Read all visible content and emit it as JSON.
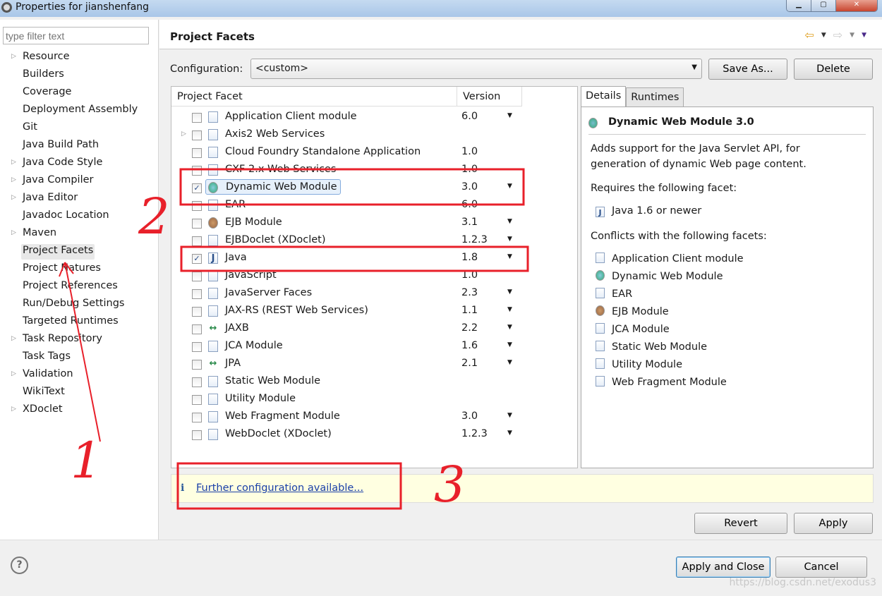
{
  "window": {
    "title": "Properties for jianshenfang",
    "controls": [
      "minimize",
      "maximize",
      "close"
    ]
  },
  "sidebar": {
    "filter_placeholder": "type filter text",
    "items": [
      {
        "label": "Resource",
        "expandable": true
      },
      {
        "label": "Builders"
      },
      {
        "label": "Coverage"
      },
      {
        "label": "Deployment Assembly"
      },
      {
        "label": "Git"
      },
      {
        "label": "Java Build Path"
      },
      {
        "label": "Java Code Style",
        "expandable": true
      },
      {
        "label": "Java Compiler",
        "expandable": true
      },
      {
        "label": "Java Editor",
        "expandable": true
      },
      {
        "label": "Javadoc Location"
      },
      {
        "label": "Maven",
        "expandable": true
      },
      {
        "label": "Project Facets",
        "selected": true
      },
      {
        "label": "Project Natures"
      },
      {
        "label": "Project References"
      },
      {
        "label": "Run/Debug Settings"
      },
      {
        "label": "Targeted Runtimes"
      },
      {
        "label": "Task Repository",
        "expandable": true
      },
      {
        "label": "Task Tags"
      },
      {
        "label": "Validation",
        "expandable": true
      },
      {
        "label": "WikiText"
      },
      {
        "label": "XDoclet",
        "expandable": true
      }
    ]
  },
  "main": {
    "title": "Project Facets",
    "configuration_label": "Configuration:",
    "configuration_value": "<custom>",
    "save_as": "Save As...",
    "delete": "Delete",
    "columns": [
      "Project Facet",
      "Version"
    ],
    "facets": [
      {
        "name": "Application Client module",
        "version": "6.0",
        "dropdown": true,
        "checked": false,
        "icon": "doc"
      },
      {
        "name": "Axis2 Web Services",
        "version": "",
        "dropdown": false,
        "checked": false,
        "icon": "doc",
        "expandable": true
      },
      {
        "name": "Cloud Foundry Standalone Application",
        "version": "1.0",
        "dropdown": false,
        "checked": false,
        "icon": "doc"
      },
      {
        "name": "CXF 2.x Web Services",
        "version": "1.0",
        "dropdown": false,
        "checked": false,
        "icon": "doc"
      },
      {
        "name": "Dynamic Web Module",
        "version": "3.0",
        "dropdown": true,
        "checked": true,
        "icon": "web",
        "selected": true
      },
      {
        "name": "EAR",
        "version": "6.0",
        "dropdown": false,
        "checked": false,
        "icon": "doc"
      },
      {
        "name": "EJB Module",
        "version": "3.1",
        "dropdown": true,
        "checked": false,
        "icon": "ejb"
      },
      {
        "name": "EJBDoclet (XDoclet)",
        "version": "1.2.3",
        "dropdown": true,
        "checked": false,
        "icon": "doc"
      },
      {
        "name": "Java",
        "version": "1.8",
        "dropdown": true,
        "checked": true,
        "icon": "java"
      },
      {
        "name": "JavaScript",
        "version": "1.0",
        "dropdown": false,
        "checked": false,
        "icon": "doc"
      },
      {
        "name": "JavaServer Faces",
        "version": "2.3",
        "dropdown": true,
        "checked": false,
        "icon": "doc"
      },
      {
        "name": "JAX-RS (REST Web Services)",
        "version": "1.1",
        "dropdown": true,
        "checked": false,
        "icon": "doc"
      },
      {
        "name": "JAXB",
        "version": "2.2",
        "dropdown": true,
        "checked": false,
        "icon": "arrows"
      },
      {
        "name": "JCA Module",
        "version": "1.6",
        "dropdown": true,
        "checked": false,
        "icon": "doc"
      },
      {
        "name": "JPA",
        "version": "2.1",
        "dropdown": true,
        "checked": false,
        "icon": "arrows"
      },
      {
        "name": "Static Web Module",
        "version": "",
        "dropdown": false,
        "checked": false,
        "icon": "doc"
      },
      {
        "name": "Utility Module",
        "version": "",
        "dropdown": false,
        "checked": false,
        "icon": "doc"
      },
      {
        "name": "Web Fragment Module",
        "version": "3.0",
        "dropdown": true,
        "checked": false,
        "icon": "doc"
      },
      {
        "name": "WebDoclet (XDoclet)",
        "version": "1.2.3",
        "dropdown": true,
        "checked": false,
        "icon": "doc"
      }
    ],
    "details": {
      "tabs": [
        "Details",
        "Runtimes"
      ],
      "title": "Dynamic Web Module 3.0",
      "desc1": "Adds support for the Java Servlet API, for",
      "desc2": "generation of dynamic Web page content.",
      "requires_label": "Requires the following facet:",
      "requires": [
        {
          "name": "Java 1.6 or newer",
          "icon": "java"
        }
      ],
      "conflicts_label": "Conflicts with the following facets:",
      "conflicts": [
        {
          "name": "Application Client module",
          "icon": "doc"
        },
        {
          "name": "Dynamic Web Module",
          "icon": "web"
        },
        {
          "name": "EAR",
          "icon": "doc"
        },
        {
          "name": "EJB Module",
          "icon": "ejb"
        },
        {
          "name": "JCA Module",
          "icon": "doc"
        },
        {
          "name": "Static Web Module",
          "icon": "doc"
        },
        {
          "name": "Utility Module",
          "icon": "doc"
        },
        {
          "name": "Web Fragment Module",
          "icon": "doc"
        }
      ]
    },
    "info_link": "Further configuration available...",
    "revert": "Revert",
    "apply": "Apply"
  },
  "footer": {
    "help": "?",
    "apply_close": "Apply and Close",
    "cancel": "Cancel",
    "watermark": "https://blog.csdn.net/exodus3"
  },
  "annotations": {
    "color": "#e8202a",
    "labels": [
      "1",
      "2",
      "3"
    ]
  }
}
